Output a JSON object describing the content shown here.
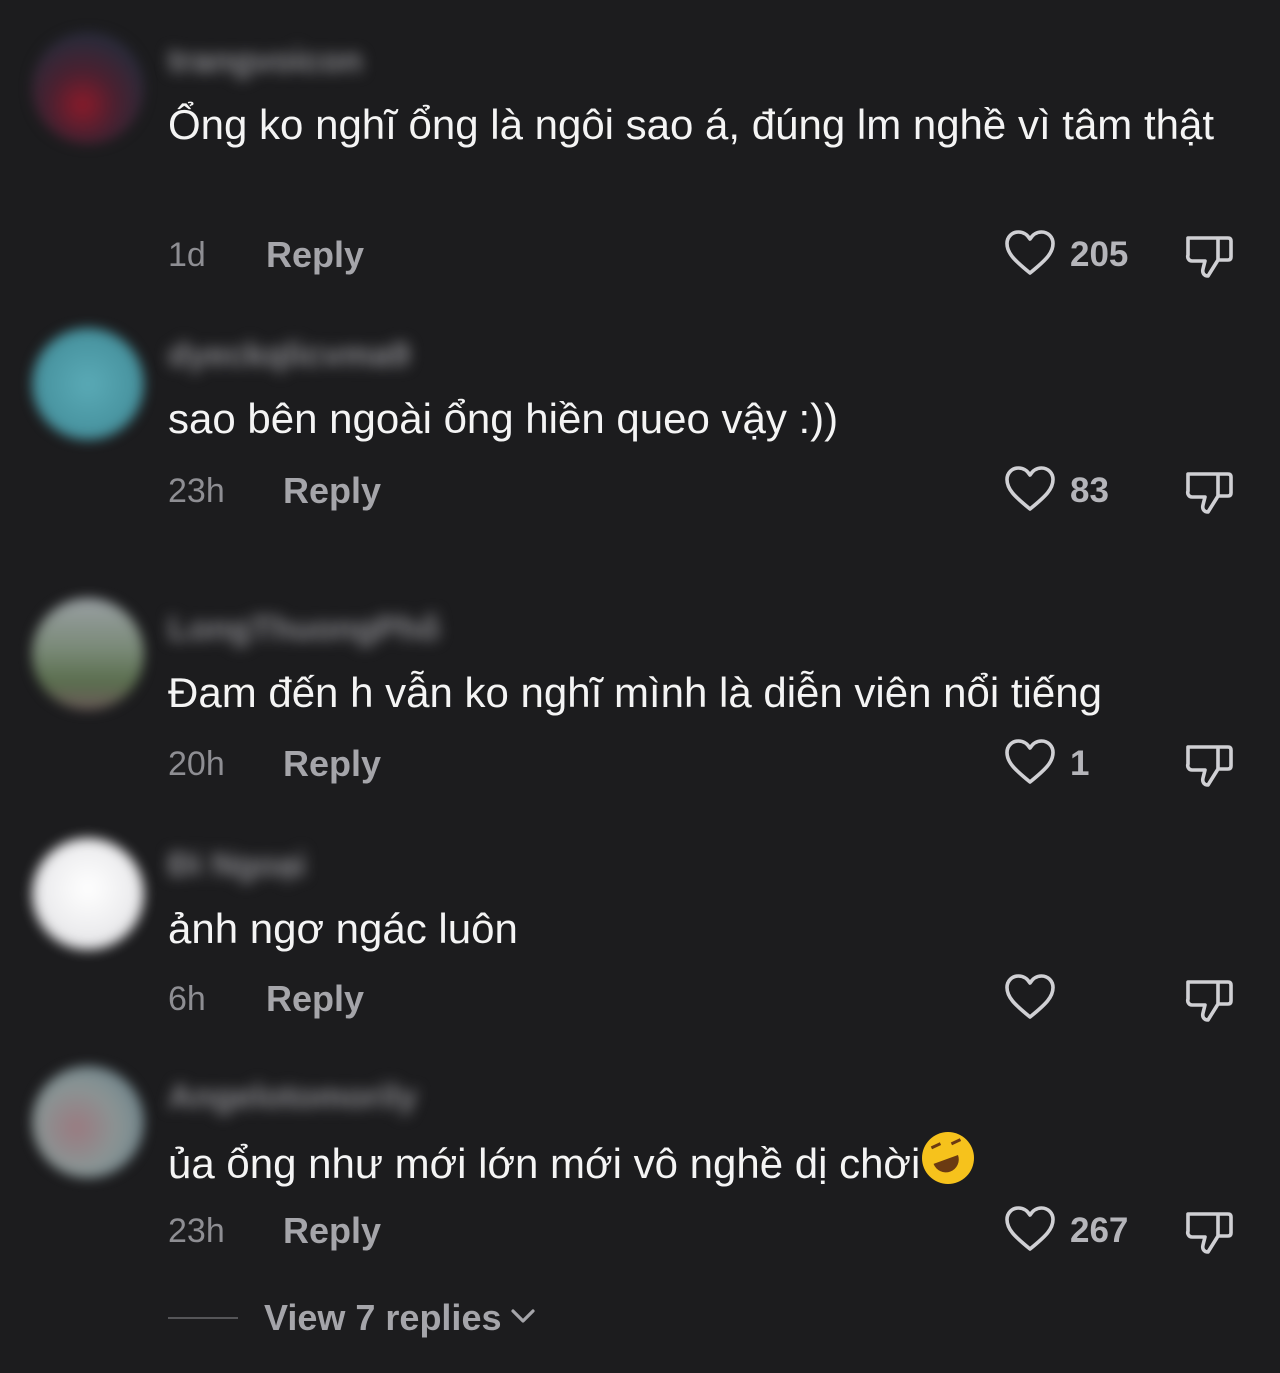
{
  "colors": {
    "background": "#1c1c1e",
    "text": "#f4f4f4",
    "muted": "#8e8e93",
    "reply": "#a5a5aa"
  },
  "comments": [
    {
      "username": "trangvoicon",
      "avatar_color": "#3a2a32",
      "text": "Ổng ko nghĩ ổng là ngôi sao á, đúng lm nghề vì tâm thật",
      "time": "1d",
      "reply_label": "Reply",
      "likes": "205",
      "like_icon": "heart-icon",
      "dislike_icon": "thumbs-down-icon"
    },
    {
      "username": "dyeckqlicvma9",
      "avatar_color": "#4a9aa8",
      "text": "sao bên ngoài ổng hiền queo vậy :))",
      "time": "23h",
      "reply_label": "Reply",
      "likes": "83",
      "like_icon": "heart-icon",
      "dislike_icon": "thumbs-down-icon"
    },
    {
      "username": "LongThuongPhố",
      "avatar_color": "#6a7a68",
      "text": "Đam đến h vẫn ko nghĩ mình là diễn viên nổi tiếng",
      "time": "20h",
      "reply_label": "Reply",
      "likes": "1",
      "like_icon": "heart-icon",
      "dislike_icon": "thumbs-down-icon"
    },
    {
      "username": "Đi Ngoại",
      "avatar_color": "#e8e8ea",
      "text": "ảnh ngơ ngác luôn",
      "time": "6h",
      "reply_label": "Reply",
      "likes": "",
      "like_icon": "heart-icon",
      "dislike_icon": "thumbs-down-icon"
    },
    {
      "username": "Angelotomorily",
      "avatar_color": "#8a9090",
      "text": "ủa ổng như mới lớn mới vô nghề dị chời",
      "emoji": "rolling-on-floor-laughing-emoji",
      "time": "23h",
      "reply_label": "Reply",
      "likes": "267",
      "like_icon": "heart-icon",
      "dislike_icon": "thumbs-down-icon"
    }
  ],
  "view_replies": {
    "label": "View 7 replies",
    "icon": "chevron-down-icon"
  }
}
